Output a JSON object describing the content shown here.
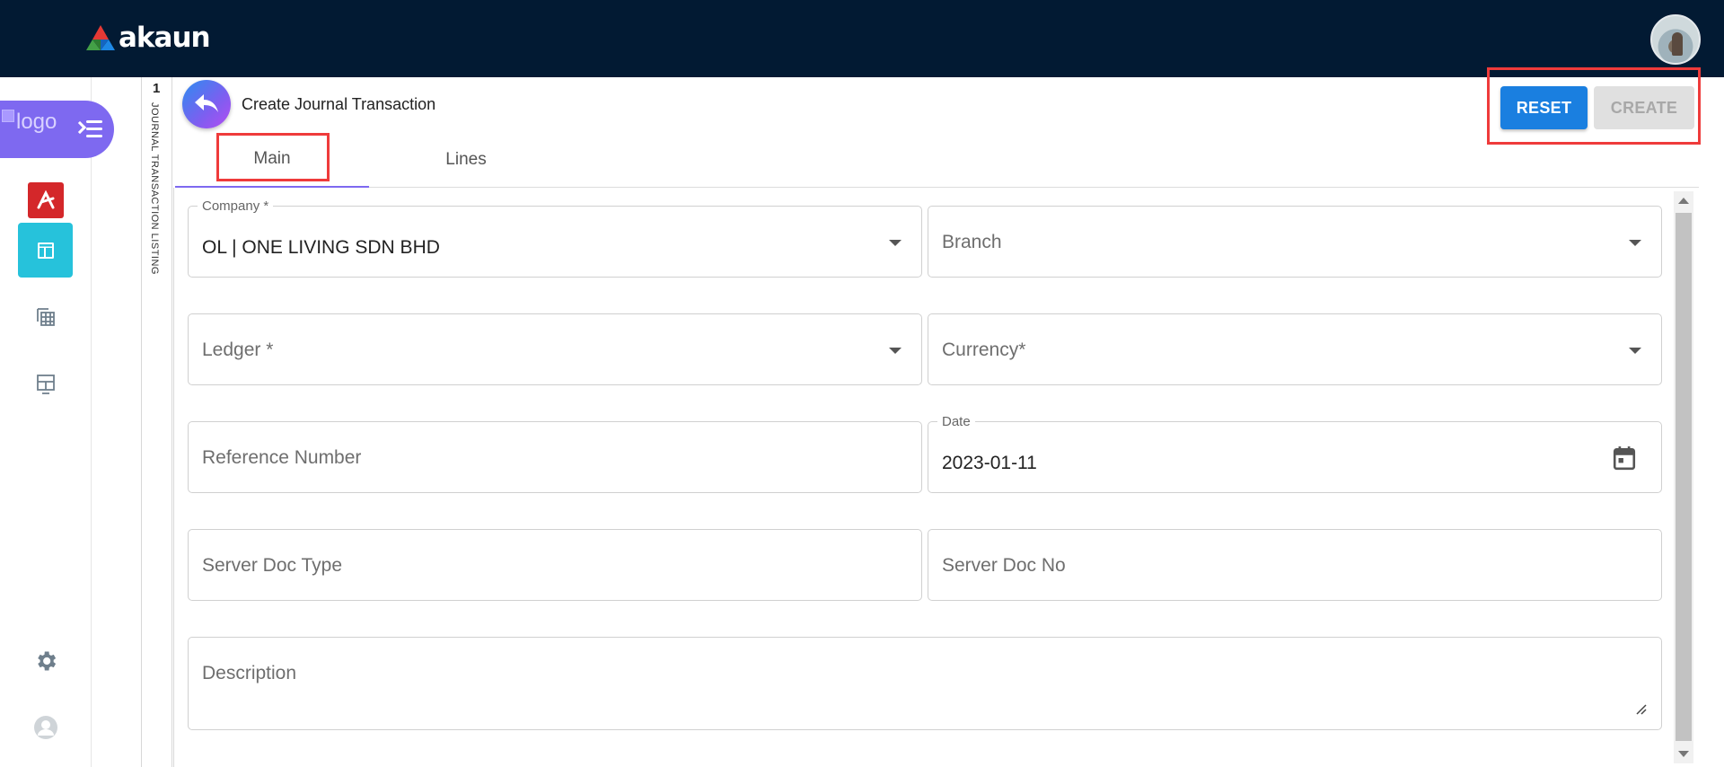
{
  "header": {
    "brand": "akaun",
    "brand_colors": [
      "#e53935",
      "#43a047",
      "#1e88e5"
    ],
    "avatar": "user-avatar-photo"
  },
  "sidebar": {
    "logo_alt": "logo",
    "items": [
      {
        "icon": "app-logo-icon"
      },
      {
        "icon": "dashboard-icon",
        "active": true,
        "color": "#26c2db"
      },
      {
        "icon": "table-list-icon"
      },
      {
        "icon": "layout-icon"
      },
      {
        "icon": "gear-icon"
      },
      {
        "icon": "user-icon"
      }
    ]
  },
  "strip": {
    "number": "1",
    "label": "JOURNAL TRANSACTION LISTING"
  },
  "page": {
    "title": "Create Journal Transaction",
    "reset_label": "RESET",
    "create_label": "CREATE"
  },
  "tabs": [
    {
      "label": "Main",
      "active": true
    },
    {
      "label": "Lines",
      "active": false
    }
  ],
  "form": {
    "company": {
      "label": "Company *",
      "value": "OL | ONE LIVING SDN BHD"
    },
    "branch": {
      "placeholder": "Branch"
    },
    "ledger": {
      "placeholder": "Ledger *"
    },
    "currency": {
      "placeholder": "Currency*"
    },
    "reference": {
      "placeholder": "Reference Number"
    },
    "date": {
      "label": "Date",
      "value": "2023-01-11"
    },
    "server_doc_type": {
      "placeholder": "Server Doc Type"
    },
    "server_doc_no": {
      "placeholder": "Server Doc No"
    },
    "description": {
      "placeholder": "Description"
    }
  },
  "colors": {
    "topbar": "#021a33",
    "accent_purple": "#7e69f0",
    "reset_blue": "#1a7fe0",
    "highlight_red": "#ef3b3b"
  }
}
